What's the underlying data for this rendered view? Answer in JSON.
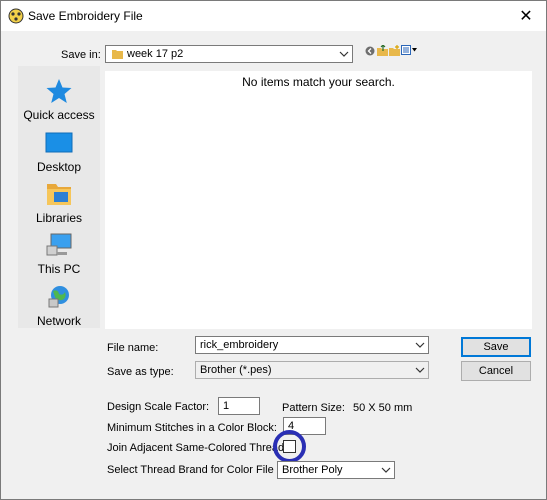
{
  "window": {
    "title": "Save Embroidery File",
    "close_glyph": "✕"
  },
  "save_in": {
    "label": "Save in:",
    "value": "week 17 p2"
  },
  "nav": {
    "items": [
      {
        "label": "Quick access",
        "icon": "star-icon"
      },
      {
        "label": "Desktop",
        "icon": "desktop-icon"
      },
      {
        "label": "Libraries",
        "icon": "libraries-icon"
      },
      {
        "label": "This PC",
        "icon": "computer-icon"
      },
      {
        "label": "Network",
        "icon": "network-icon"
      }
    ]
  },
  "file_list": {
    "empty_message": "No items match your search."
  },
  "file_name": {
    "label": "File name:",
    "value": "rick_embroidery"
  },
  "save_as_type": {
    "label": "Save as type:",
    "value": "Brother (*.pes)"
  },
  "buttons": {
    "save": "Save",
    "cancel": "Cancel"
  },
  "options": {
    "design_scale_label": "Design Scale Factor:",
    "design_scale_value": "1",
    "pattern_size_label": "Pattern Size:",
    "pattern_size_value": "50 X 50 mm",
    "min_stitches_label": "Minimum Stitches in a Color Block:",
    "min_stitches_value": "4",
    "join_threads_label": "Join Adjacent Same-Colored Threads",
    "join_threads_checked": false,
    "thread_brand_label": "Select Thread Brand for Color File",
    "thread_brand_value": "Brother Poly"
  },
  "colors": {
    "highlight_ring": "#2a2fb4",
    "default_button_border": "#0078d7"
  }
}
